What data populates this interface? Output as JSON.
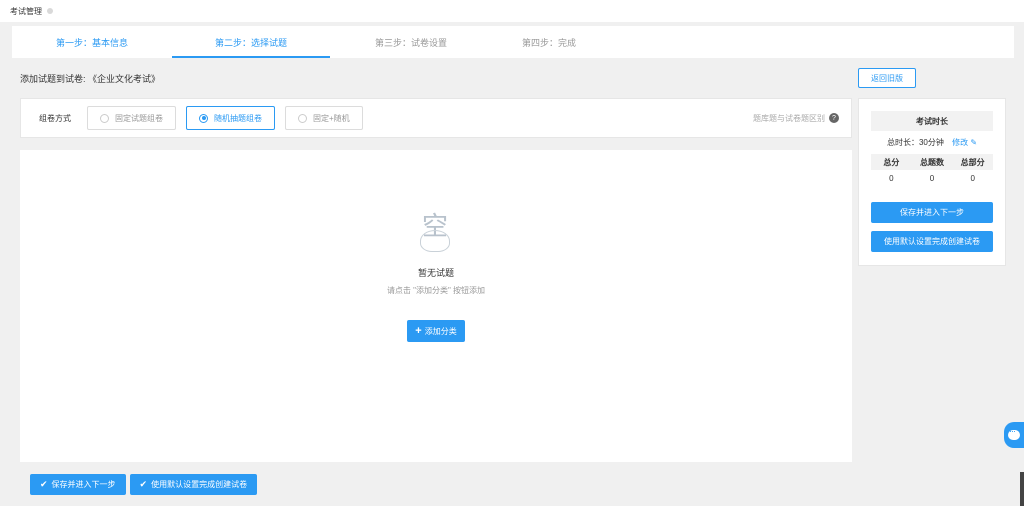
{
  "header": {
    "title": "考试管理"
  },
  "steps": [
    {
      "label": "第一步：基本信息",
      "state": "done"
    },
    {
      "label": "第二步：选择试题",
      "state": "active"
    },
    {
      "label": "第三步：试卷设置",
      "state": "pending"
    },
    {
      "label": "第四步：完成",
      "state": "pending"
    }
  ],
  "heading": "添加试题到试卷: 《企业文化考试》",
  "back_button": "返回旧版",
  "compose": {
    "label": "组卷方式",
    "options": [
      {
        "label": "固定试题组卷",
        "selected": false
      },
      {
        "label": "随机抽题组卷",
        "selected": true
      },
      {
        "label": "固定+随机",
        "selected": false
      }
    ],
    "diff_link": "题库题与试卷题区别",
    "help_icon": "?"
  },
  "empty_state": {
    "glyph": "空",
    "title": "暂无试题",
    "subtitle": "请点击 \"添加分类\" 按钮添加",
    "add_button": "添加分类"
  },
  "side_panel": {
    "title": "考试时长",
    "total_duration": "总时长：30分钟",
    "edit_label": "修改",
    "stats_headers": [
      "总分",
      "总题数",
      "总部分"
    ],
    "stats_values": [
      "0",
      "0",
      "0"
    ],
    "save_next": "保存并进入下一步",
    "use_default": "使用默认设置完成创建试卷"
  },
  "bottom": {
    "save_next": "保存并进入下一步",
    "use_default": "使用默认设置完成创建试卷"
  },
  "colors": {
    "accent": "#2b9af3",
    "page_bg": "#f0f0f0"
  }
}
